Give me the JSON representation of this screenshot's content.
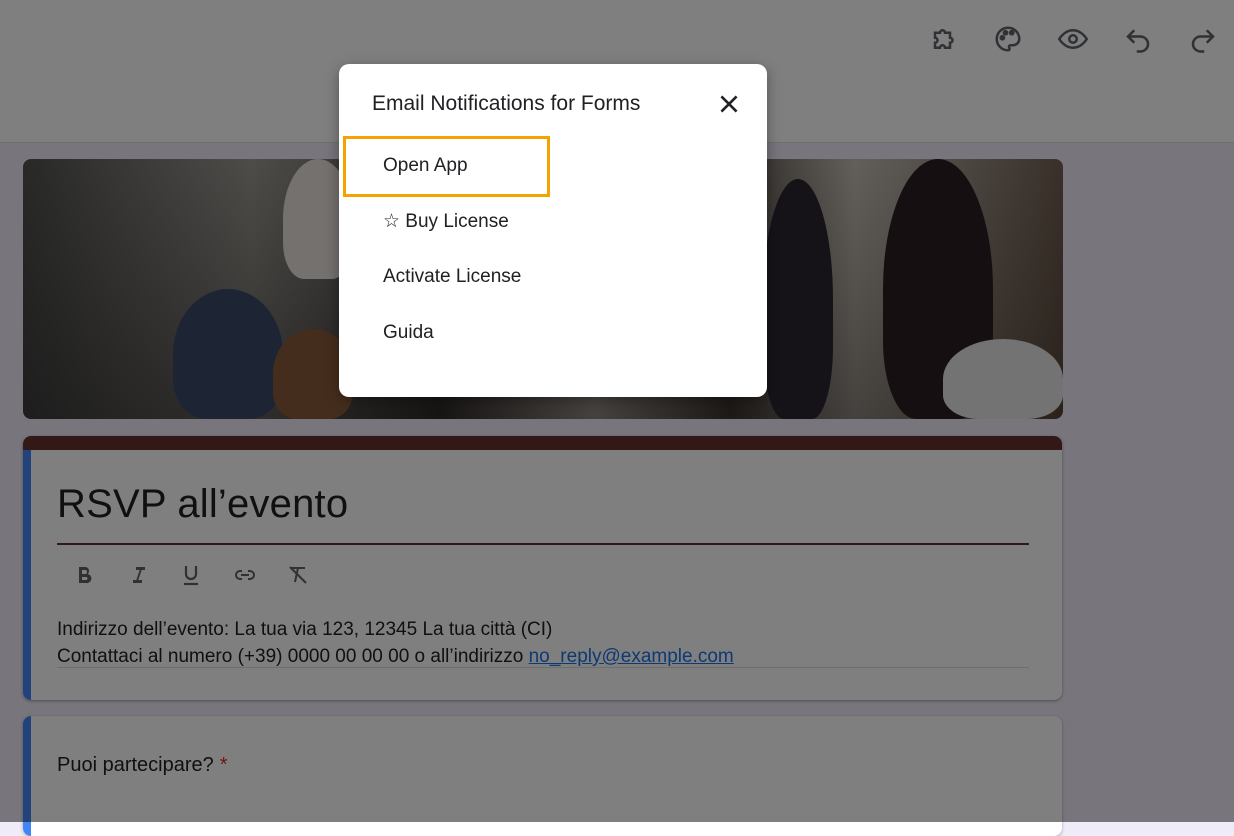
{
  "toolbar": {
    "icons": [
      "addon-puzzle-icon",
      "palette-icon",
      "preview-eye-icon",
      "undo-icon",
      "redo-icon"
    ]
  },
  "form": {
    "title": "RSVP all’evento",
    "description_line1": "Indirizzo dell’evento: La tua via 123, 12345 La tua città (CI)",
    "description_line2_prefix": "Contattaci al numero (+39) 0000 00 00 00 o all’indirizzo ",
    "description_email": "no_reply@example.com",
    "format_icons": [
      "bold-icon",
      "italic-icon",
      "underline-icon",
      "link-icon",
      "clear-format-icon"
    ],
    "accent_color": "#673030",
    "question": {
      "text": "Puoi partecipare?",
      "required_marker": "*"
    }
  },
  "dialog": {
    "title": "Email Notifications for Forms",
    "close_icon": "close-icon",
    "items": [
      {
        "label": "Open App",
        "highlighted": true
      },
      {
        "label": "☆ Buy License"
      },
      {
        "label": "Activate License"
      },
      {
        "label": "Guida"
      }
    ],
    "highlight_color": "#f4a300"
  }
}
